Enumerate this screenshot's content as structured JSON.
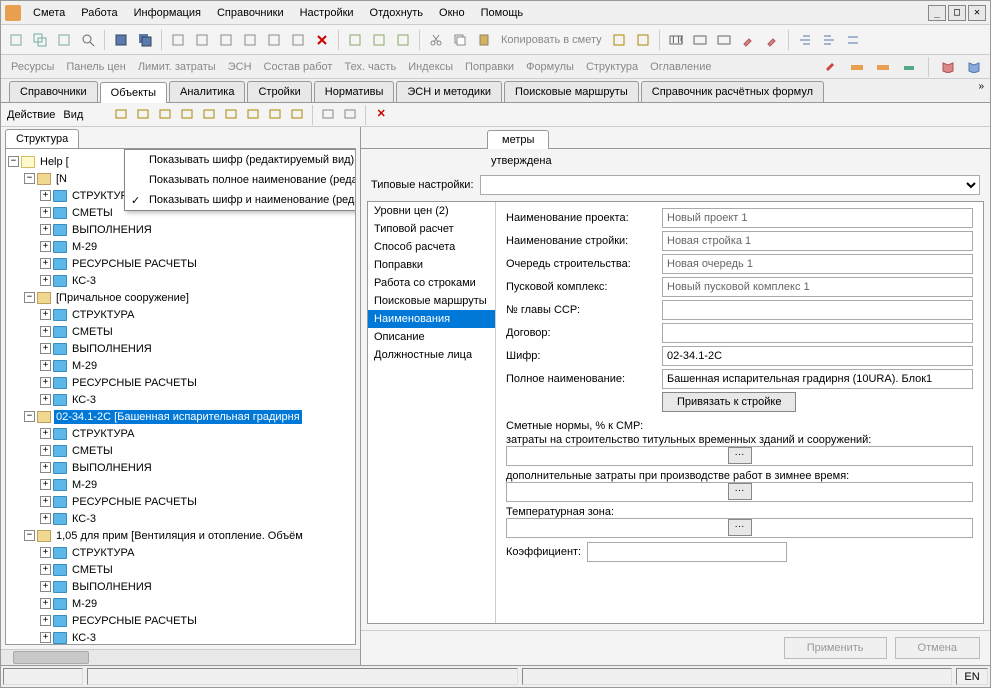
{
  "menu": [
    "Смета",
    "Работа",
    "Информация",
    "Справочники",
    "Настройки",
    "Отдохнуть",
    "Окно",
    "Помощь"
  ],
  "toolbar_text": "Копировать в смету",
  "linkbar": [
    "Ресурсы",
    "Панель цен",
    "Лимит. затраты",
    "ЭСН",
    "Состав работ",
    "Тех. часть",
    "Индексы",
    "Поправки",
    "Формулы",
    "Структура",
    "Оглавление"
  ],
  "main_tabs": [
    "Справочники",
    "Объекты",
    "Аналитика",
    "Стройки",
    "Нормативы",
    "ЭСН и методики",
    "Поисковые маршруты",
    "Справочник расчётных формул"
  ],
  "actions": {
    "deistvie": "Действие",
    "vid": "Вид"
  },
  "context_menu": [
    {
      "label": "Показывать шифр (редактируемый вид)",
      "checked": false
    },
    {
      "label": "Показывать полное наименование (редактируемый вид)",
      "checked": false
    },
    {
      "label": "Показывать шифр и наименование (редактируемый вид)",
      "checked": true
    }
  ],
  "left_tab": "Структура",
  "tree_root": "Help [",
  "tree_groups": [
    {
      "name": "[N",
      "children": [
        "СТРУКТУРА",
        "СМЕТЫ",
        "ВЫПОЛНЕНИЯ",
        "М-29",
        "РЕСУРСНЫЕ РАСЧЕТЫ",
        "КС-3"
      ],
      "indent": 1
    },
    {
      "name": "[Причальное сооружение]",
      "children": [
        "СТРУКТУРА",
        "СМЕТЫ",
        "ВЫПОЛНЕНИЯ",
        "М-29",
        "РЕСУРСНЫЕ РАСЧЕТЫ",
        "КС-3"
      ],
      "indent": 1
    },
    {
      "name": "02-34.1-2С [Башенная испарительная градирня",
      "children": [
        "СТРУКТУРА",
        "СМЕТЫ",
        "ВЫПОЛНЕНИЯ",
        "М-29",
        "РЕСУРСНЫЕ РАСЧЕТЫ",
        "КС-3"
      ],
      "selected": true,
      "indent": 1
    },
    {
      "name": "1,05 для прим [Вентиляция и отопление. Объём",
      "children": [
        "СТРУКТУРА",
        "СМЕТЫ",
        "ВЫПОЛНЕНИЯ",
        "М-29",
        "РЕСУРСНЫЕ РАСЧЕТЫ",
        "КС-3"
      ],
      "indent": 1
    }
  ],
  "right_tab": "метры",
  "status_text": "утверждена",
  "settings_label": "Типовые настройки:",
  "detail_nav": [
    "Уровни цен (2)",
    "Типовой расчет",
    "Способ расчета",
    "Поправки",
    "Работа со строками",
    "Поисковые маршруты",
    "Наименования",
    "Описание",
    "Должностные лица"
  ],
  "detail_nav_selected": "Наименования",
  "form": {
    "project_label": "Наименование проекта:",
    "project_value": "Новый проект 1",
    "stroyka_label": "Наименование стройки:",
    "stroyka_value": "Новая стройка 1",
    "ochered_label": "Очередь строительства:",
    "ochered_value": "Новая очередь 1",
    "komplex_label": "Пусковой комплекс:",
    "komplex_value": "Новый пусковой комплекс 1",
    "glava_label": "№ главы ССР:",
    "dogovor_label": "Договор:",
    "shifr_label": "Шифр:",
    "shifr_value": "02-34.1-2С",
    "fullname_label": "Полное наименование:",
    "fullname_value": "Башенная испарительная градирня (10URA). Блок1",
    "bind_btn": "Привязать к стройке",
    "norms_title": "Сметные нормы, % к СМР:",
    "norms_titul": "затраты на строительство титульных временных зданий и сооружений:",
    "norms_winter": "дополнительные затраты при производстве работ в зимнее время:",
    "tempzone_label": "Температурная зона:",
    "koef_label": "Коэффициент:"
  },
  "buttons": {
    "apply": "Применить",
    "cancel": "Отмена"
  },
  "status_lang": "EN"
}
